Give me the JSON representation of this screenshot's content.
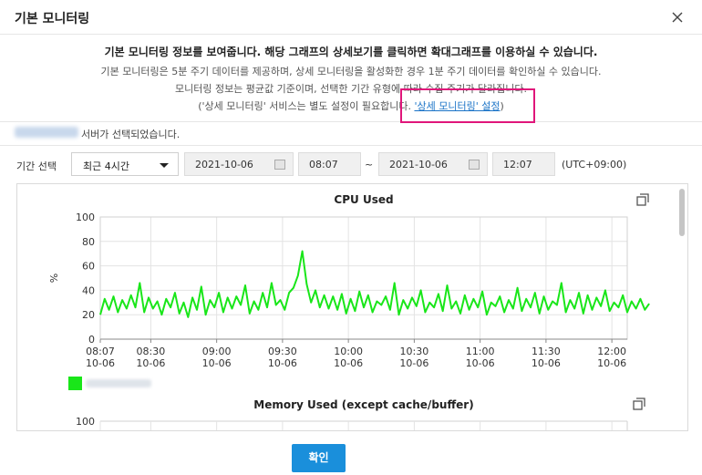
{
  "dialog": {
    "title": "기본 모니터링",
    "close_icon": "close-icon"
  },
  "info": {
    "line1": "기본 모니터링 정보를 보여줍니다. 해당 그래프의 상세보기를 클릭하면 확대그래프를 이용하실 수 있습니다.",
    "line2": "기본 모니터링은 5분 주기 데이터를 제공하며, 상세 모니터링을 활성화한 경우 1분 주기 데이터를 확인하실 수 있습니다.",
    "line3": "모니터링 정보는 평균값 기준이며, 선택한 기간 유형에 따라 수집 주기가 달라집니다.",
    "line4_prefix": "('상세 모니터링' 서비스는 별도 설정이 필요합니다. ",
    "line4_link": "'상세 모니터링' 설정",
    "line4_suffix": ")"
  },
  "selected_server": {
    "text": "서버가 선택되었습니다."
  },
  "period": {
    "label": "기간 선택",
    "range_value": "최근 4시간",
    "start_date": "2021-10-06",
    "start_time": "08:07",
    "separator": "~",
    "end_date": "2021-10-06",
    "end_time": "12:07",
    "timezone": "(UTC+09:00)"
  },
  "footer": {
    "ok_label": "확인"
  },
  "colors": {
    "series": "#19e619",
    "primary_button": "#1a8fdb",
    "link": "#1a73c7",
    "highlight": "#e0167a"
  },
  "chart_data": [
    {
      "type": "line",
      "title": "CPU Used",
      "ylabel": "%",
      "ylim": [
        0,
        100
      ],
      "y_ticks": [
        "0",
        "20",
        "40",
        "60",
        "80",
        "100"
      ],
      "x_ticks": [
        {
          "time": "08:07",
          "date": "10-06"
        },
        {
          "time": "08:30",
          "date": "10-06"
        },
        {
          "time": "09:00",
          "date": "10-06"
        },
        {
          "time": "09:30",
          "date": "10-06"
        },
        {
          "time": "10:00",
          "date": "10-06"
        },
        {
          "time": "10:30",
          "date": "10-06"
        },
        {
          "time": "11:00",
          "date": "10-06"
        },
        {
          "time": "11:30",
          "date": "10-06"
        },
        {
          "time": "12:00",
          "date": "10-06"
        }
      ],
      "grid": true,
      "legend": "bottom-left",
      "series": [
        {
          "x_start": "08:07",
          "x_end": "12:07",
          "interval_minutes": 2,
          "values": [
            20,
            33,
            24,
            35,
            22,
            32,
            25,
            36,
            26,
            46,
            22,
            34,
            25,
            31,
            20,
            33,
            26,
            38,
            21,
            30,
            18,
            34,
            24,
            43,
            20,
            32,
            26,
            38,
            22,
            34,
            25,
            35,
            28,
            44,
            21,
            31,
            24,
            38,
            26,
            46,
            28,
            32,
            24,
            38,
            42,
            52,
            72,
            45,
            30,
            40,
            26,
            36,
            25,
            35,
            24,
            37,
            21,
            33,
            23,
            39,
            26,
            36,
            22,
            31,
            28,
            35,
            24,
            46,
            20,
            32,
            25,
            34,
            27,
            40,
            22,
            30,
            26,
            37,
            23,
            44,
            25,
            31,
            21,
            36,
            24,
            33,
            26,
            39,
            20,
            30,
            27,
            35,
            22,
            32,
            25,
            42,
            23,
            33,
            26,
            38,
            21,
            35,
            24,
            31,
            28,
            46,
            22,
            32,
            25,
            38,
            21,
            36,
            24,
            34,
            27,
            40,
            23,
            30,
            26,
            36,
            22,
            31,
            25,
            33,
            24,
            29
          ]
        }
      ]
    },
    {
      "type": "line",
      "title": "Memory Used (except cache/buffer)",
      "ylabel": "%",
      "ylim": [
        0,
        100
      ],
      "y_ticks": [
        "100"
      ],
      "grid": true
    }
  ]
}
